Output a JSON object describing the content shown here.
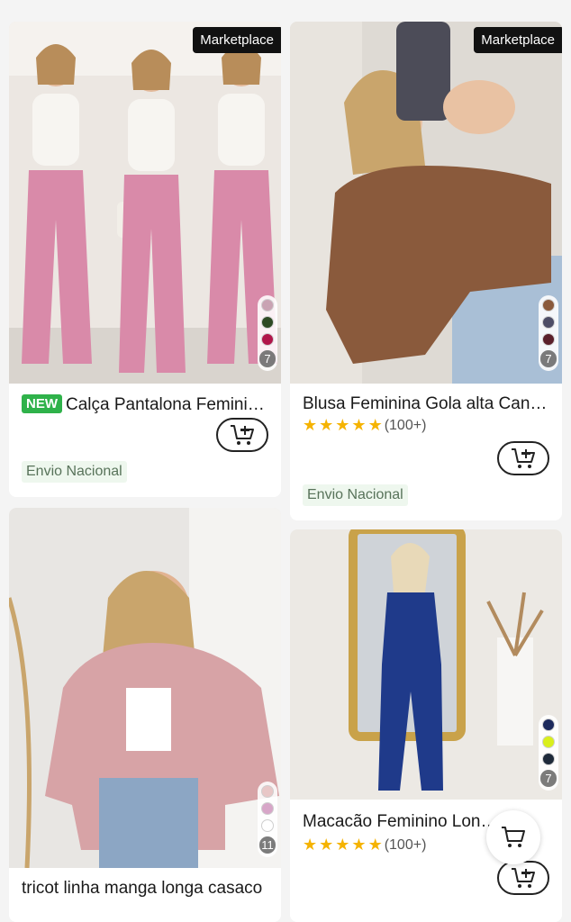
{
  "products": [
    {
      "badge": "Marketplace",
      "new_label": "NEW",
      "title": "Calça Pantalona Feminina Canelada",
      "shipping": "Envio Nacional",
      "swatches": [
        "#c9a3b3",
        "#2e4a24",
        "#b0154a"
      ],
      "swatch_count": "7",
      "cart_icon": "add-to-cart-icon"
    },
    {
      "badge": "Marketplace",
      "title": "Blusa Feminina Gola alta Canelada",
      "rating": "(100+)",
      "shipping": "Envio Nacional",
      "swatches": [
        "#8a5a3c",
        "#4d4d66",
        "#5a1f2a"
      ],
      "swatch_count": "7",
      "cart_icon": "add-to-cart-icon"
    },
    {
      "title": "tricot linha manga longa casaco",
      "swatches": [
        "#e8c7c7",
        "#d7a6c8",
        "#ffffff"
      ],
      "swatch_count": "11",
      "cart_icon": "add-to-cart-icon"
    },
    {
      "title": "Macacão Feminino Longo Alcinha",
      "rating": "(100+)",
      "swatches": [
        "#1d2a5c",
        "#d9ef1b",
        "#1e2a3a"
      ],
      "swatch_count": "7",
      "cart_icon": "add-to-cart-icon"
    }
  ],
  "floating_cart": "cart-icon"
}
